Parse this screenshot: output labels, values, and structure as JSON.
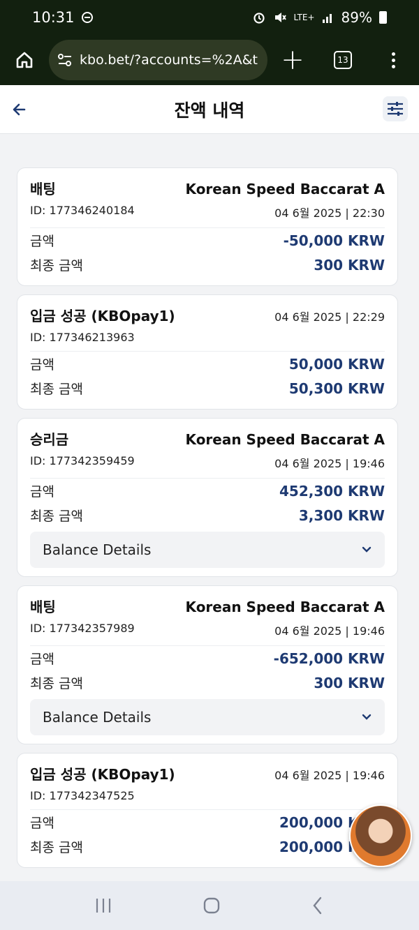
{
  "status_bar": {
    "time": "10:31",
    "network": "LTE+",
    "battery": "89%"
  },
  "browser": {
    "url": "kbo.bet/?accounts=%2A&t",
    "tab_count": "13"
  },
  "header": {
    "title": "잔액 내역"
  },
  "transactions": [
    {
      "type": "배팅",
      "game": "Korean Speed Baccarat A",
      "id": "ID: 177346240184",
      "datetime": "04 6월 2025 | 22:30",
      "amount_label": "금액",
      "amount": "-50,000 KRW",
      "final_label": "최종 금액",
      "final": "300 KRW"
    },
    {
      "type": "입금 성공 (KBOpay1)",
      "game": "",
      "id": "ID: 177346213963",
      "datetime": "04 6월 2025 | 22:29",
      "amount_label": "금액",
      "amount": "50,000 KRW",
      "final_label": "최종 금액",
      "final": "50,300 KRW"
    },
    {
      "type": "승리금",
      "game": "Korean Speed Baccarat A",
      "id": "ID: 177342359459",
      "datetime": "04 6월 2025 | 19:46",
      "amount_label": "금액",
      "amount": "452,300 KRW",
      "final_label": "최종 금액",
      "final": "3,300 KRW",
      "details_label": "Balance Details"
    },
    {
      "type": "배팅",
      "game": "Korean Speed Baccarat A",
      "id": "ID: 177342357989",
      "datetime": "04 6월 2025 | 19:46",
      "amount_label": "금액",
      "amount": "-652,000 KRW",
      "final_label": "최종 금액",
      "final": "300 KRW",
      "details_label": "Balance Details"
    },
    {
      "type": "입금 성공 (KBOpay1)",
      "game": "",
      "id": "ID: 177342347525",
      "datetime": "04 6월 2025 | 19:46",
      "amount_label": "금액",
      "amount": "200,000 KRW",
      "final_label": "최종 금액",
      "final": "200,000 KRW"
    }
  ],
  "icons": {
    "home": "home-icon",
    "site_settings": "tune-icon",
    "new_tab": "plus-icon",
    "menu": "more-vert-icon",
    "back": "arrow-left-icon",
    "filter": "sliders-icon",
    "expand": "chevron-down-icon",
    "nav_recent": "recent-apps-icon",
    "nav_home": "home-circle-icon",
    "nav_back": "back-chevron-icon"
  },
  "colors": {
    "amount": "#1e3a72",
    "chrome": "#12200f",
    "background": "#f2f3f5"
  }
}
